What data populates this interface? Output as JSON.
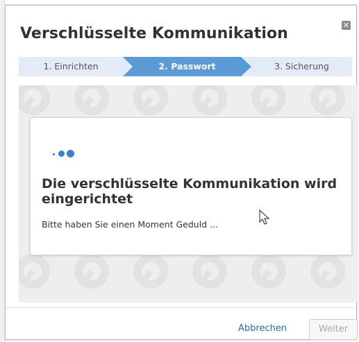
{
  "dialog": {
    "title": "Verschlüsselte Kommunikation",
    "close_icon": "close-icon"
  },
  "steps": [
    {
      "label": "1. Einrichten",
      "active": false
    },
    {
      "label": "2. Passwort",
      "active": true
    },
    {
      "label": "3. Sicherung",
      "active": false
    }
  ],
  "progress": {
    "heading": "Die verschlüsselte Kommunikation wird eingerichtet",
    "message": "Bitte haben Sie einen Moment Geduld ..."
  },
  "footer": {
    "cancel_label": "Abbrechen",
    "next_label": "Weiter"
  },
  "colors": {
    "accent": "#5b9bd5",
    "step_bg": "#e3ecf6",
    "link": "#2a6db5"
  }
}
